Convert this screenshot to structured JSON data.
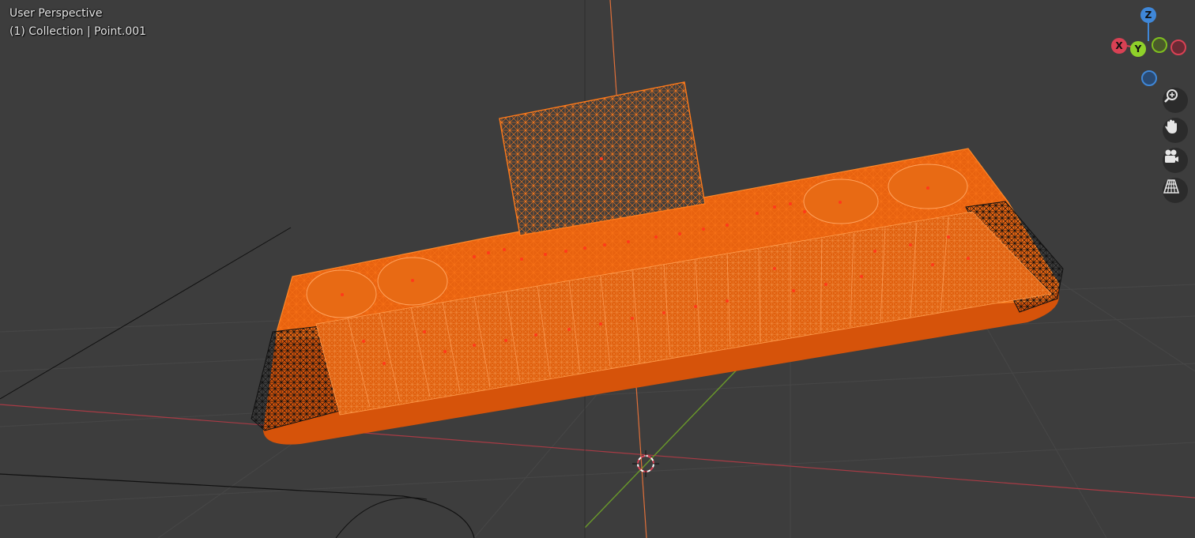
{
  "viewport": {
    "view_name": "User Perspective",
    "object_info": "(1) Collection | Point.001"
  },
  "gizmo": {
    "axes": {
      "z": "Z",
      "x": "X",
      "y": "Y"
    },
    "colors": {
      "x": "#d94154",
      "y": "#7fbf1f",
      "z": "#3f87d8",
      "selection": "#ff6a00"
    }
  },
  "nav_buttons": [
    {
      "name": "zoom-icon"
    },
    {
      "name": "hand-pan-icon"
    },
    {
      "name": "camera-icon"
    },
    {
      "name": "grid-perspective-icon"
    }
  ]
}
